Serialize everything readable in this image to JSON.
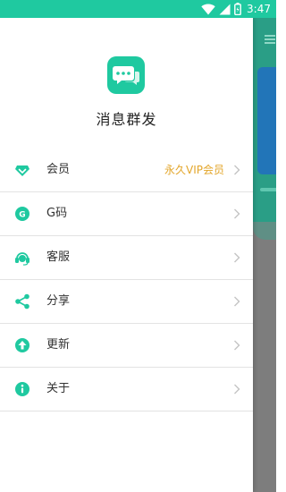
{
  "status_bar": {
    "time": "3:47",
    "icons": [
      "wifi-icon",
      "cell-signal-icon",
      "battery-icon"
    ],
    "color": "#1fc9a0"
  },
  "app": {
    "name": "消息群发",
    "logo_icon": "chat-bubbles-icon",
    "accent_color": "#1fc9a0"
  },
  "menu": {
    "items": [
      {
        "label": "会员",
        "value": "永久VIP会员",
        "icon": "diamond-icon"
      },
      {
        "label": "G码",
        "icon": "g-code-icon"
      },
      {
        "label": "客服",
        "icon": "headset-icon"
      },
      {
        "label": "分享",
        "icon": "share-icon"
      },
      {
        "label": "更新",
        "icon": "update-arrow-icon"
      },
      {
        "label": "关于",
        "icon": "info-icon"
      }
    ],
    "value_color": "#e3a62b",
    "chevron_icon": "chevron-right-icon"
  }
}
